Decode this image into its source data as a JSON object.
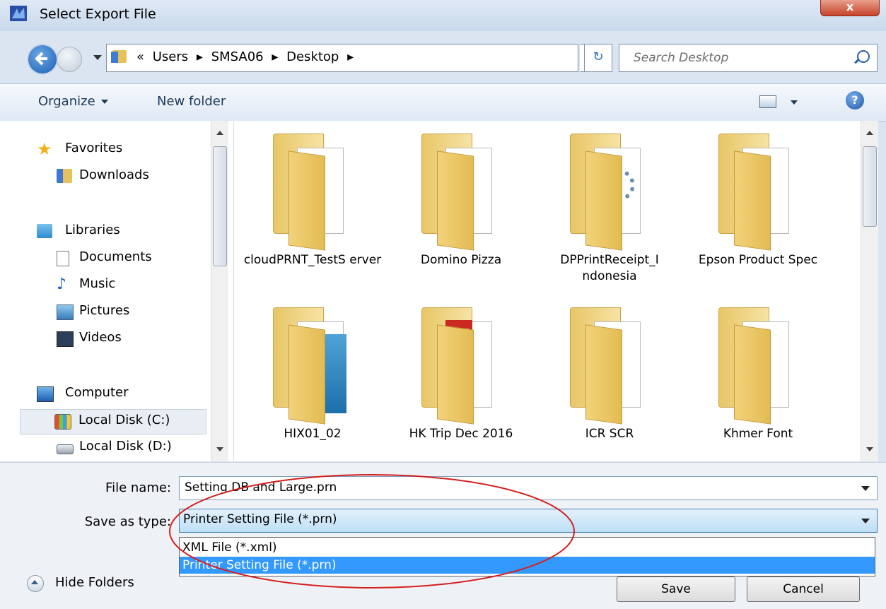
{
  "window": {
    "title": "Select Export File",
    "close_label": "x"
  },
  "address": {
    "crumb_prefix": "«",
    "crumbs": [
      "Users",
      "SMSA06",
      "Desktop"
    ],
    "separator": "▸",
    "refresh_label": "↻"
  },
  "search": {
    "placeholder": "Search Desktop"
  },
  "toolbar": {
    "organize": "Organize",
    "new_folder": "New folder",
    "help": "?"
  },
  "nav": {
    "favorites": "Favorites",
    "downloads": "Downloads",
    "libraries": "Libraries",
    "documents": "Documents",
    "music": "Music",
    "pictures": "Pictures",
    "videos": "Videos",
    "computer": "Computer",
    "disk_c": "Local Disk (C:)",
    "disk_d": "Local Disk (D:)"
  },
  "files": [
    {
      "name": "cloudPRNT_TestS erver"
    },
    {
      "name": "Domino Pizza"
    },
    {
      "name": "DPPrintReceipt_I ndonesia"
    },
    {
      "name": "Epson Product Spec"
    },
    {
      "name": "HIX01_02"
    },
    {
      "name": "HK Trip Dec 2016"
    },
    {
      "name": "ICR SCR"
    },
    {
      "name": "Khmer Font"
    }
  ],
  "form": {
    "file_name_label": "File name:",
    "file_name_value": "Setting DB and Large.prn",
    "save_as_label": "Save as type:",
    "save_as_value": "Printer Setting File (*.prn)",
    "options": [
      "XML File (*.xml)",
      "Printer Setting File (*.prn)"
    ]
  },
  "buttons": {
    "save": "Save",
    "cancel": "Cancel",
    "hide_folders": "Hide Folders"
  },
  "annotation": {
    "color": "#d41f1f"
  },
  "icons": {
    "pdf": "PDF"
  }
}
